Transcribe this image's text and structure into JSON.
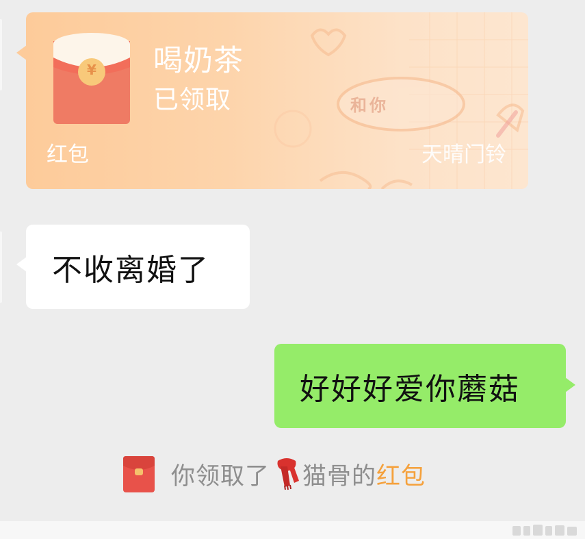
{
  "red_packet": {
    "title": "喝奶茶",
    "status": "已领取",
    "label": "红包",
    "source": "天晴门铃",
    "cover_doodle": "和你",
    "coin_symbol": "¥",
    "colors": {
      "card_start": "#fdcb9a",
      "card_end": "#fde6d0",
      "envelope": "#ef7b64",
      "envelope_flap": "#fdf5ea",
      "coin": "#f8c97a"
    }
  },
  "messages": [
    {
      "side": "left",
      "text": "不收离婚了",
      "bubble_color": "#ffffff"
    },
    {
      "side": "right",
      "text": "好好好爱你蘑菇",
      "bubble_color": "#95ec69"
    }
  ],
  "notice": {
    "icon": "red-packet-icon",
    "prefix": "你领取了",
    "emoji_icon": "scarf-icon",
    "sender": "猫骨",
    "possessive": "的",
    "link_text": "红包",
    "link_color": "#f5a13c"
  },
  "background": "#ededed"
}
